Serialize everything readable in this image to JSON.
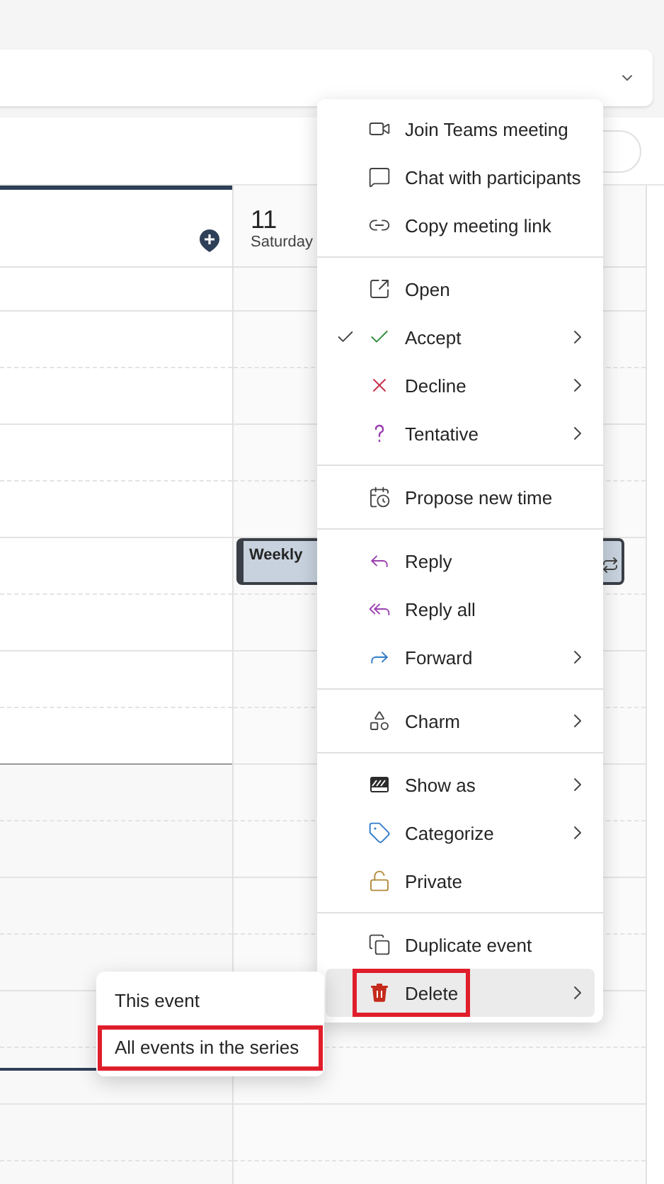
{
  "day": {
    "number": "11",
    "name": "Saturday"
  },
  "event": {
    "title": "Weekly"
  },
  "context_menu": {
    "groups": [
      [
        {
          "label": "Join Teams meeting",
          "checked": false,
          "has_submenu": false,
          "highlighted": false,
          "annotated": false
        },
        {
          "label": "Chat with participants",
          "checked": false,
          "has_submenu": false,
          "highlighted": false,
          "annotated": false
        },
        {
          "label": "Copy meeting link",
          "checked": false,
          "has_submenu": false,
          "highlighted": false,
          "annotated": false
        }
      ],
      [
        {
          "label": "Open",
          "checked": false,
          "has_submenu": false,
          "highlighted": false,
          "annotated": false
        },
        {
          "label": "Accept",
          "checked": true,
          "has_submenu": true,
          "highlighted": false,
          "annotated": false
        },
        {
          "label": "Decline",
          "checked": false,
          "has_submenu": true,
          "highlighted": false,
          "annotated": false
        },
        {
          "label": "Tentative",
          "checked": false,
          "has_submenu": true,
          "highlighted": false,
          "annotated": false
        }
      ],
      [
        {
          "label": "Propose new time",
          "checked": false,
          "has_submenu": false,
          "highlighted": false,
          "annotated": false
        }
      ],
      [
        {
          "label": "Reply",
          "checked": false,
          "has_submenu": false,
          "highlighted": false,
          "annotated": false
        },
        {
          "label": "Reply all",
          "checked": false,
          "has_submenu": false,
          "highlighted": false,
          "annotated": false
        },
        {
          "label": "Forward",
          "checked": false,
          "has_submenu": true,
          "highlighted": false,
          "annotated": false
        }
      ],
      [
        {
          "label": "Charm",
          "checked": false,
          "has_submenu": true,
          "highlighted": false,
          "annotated": false
        }
      ],
      [
        {
          "label": "Show as",
          "checked": false,
          "has_submenu": true,
          "highlighted": false,
          "annotated": false
        },
        {
          "label": "Categorize",
          "checked": false,
          "has_submenu": true,
          "highlighted": false,
          "annotated": false
        },
        {
          "label": "Private",
          "checked": false,
          "has_submenu": false,
          "highlighted": false,
          "annotated": false
        }
      ],
      [
        {
          "label": "Duplicate event",
          "checked": false,
          "has_submenu": false,
          "highlighted": false,
          "annotated": false
        },
        {
          "label": "Delete",
          "checked": false,
          "has_submenu": true,
          "highlighted": true,
          "annotated": true
        }
      ]
    ]
  },
  "delete_submenu": {
    "items": [
      {
        "label": "This event",
        "annotated": false
      },
      {
        "label": "All events in the series",
        "annotated": true
      }
    ]
  }
}
